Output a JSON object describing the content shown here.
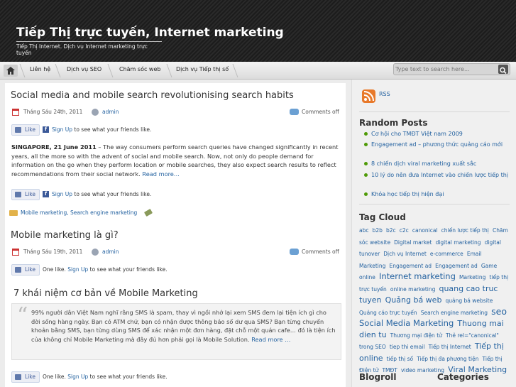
{
  "header": {
    "title": "Tiếp Thị trực tuyến, Internet marketing",
    "description": "Tiếp Thị Internet. Dịch vụ Internet marketing trực tuyến"
  },
  "nav": {
    "home_icon": "home-icon",
    "items": [
      "Liên hệ",
      "Dịch vụ SEO",
      "Chăm sóc web",
      "Dịch vụ Tiếp thị số"
    ],
    "search_placeholder": "Type text to search here..."
  },
  "posts": [
    {
      "title": "Social media and mobile search revolutionising search habits",
      "date": "Tháng Sáu 24th, 2011",
      "author": "admin",
      "comments": "Comments off",
      "like_label": "Like",
      "fb_signup_prefix": "Sign Up",
      "fb_signup_suffix": " to see what your friends like.",
      "excerpt_lead": "SINGAPORE, 21 June 2011",
      "excerpt_body": " – The way consumers perform search queries have changed significantly in recent years, all the more so with the advent of social and mobile search. Now, not only do people demand for information on the go when they perform location or mobile searches, they also expect search results to reflect recommendations from their social network. ",
      "read_more": "Read more…",
      "categories": "Mobile marketing, Search engine marketing"
    },
    {
      "title": "Mobile marketing là gì?",
      "date": "Tháng Sáu 19th, 2011",
      "author": "admin",
      "comments": "Comments off",
      "like_label": "Like",
      "fb_prefix": "One like. ",
      "fb_signup": "Sign Up",
      "fb_suffix": " to see what your friends like.",
      "subtitle": "7 khái niệm cơ bản về Mobile Marketing",
      "quote": "99% người dân Việt Nam nghĩ rằng SMS là spam, thay vì ngồi nhớ lại xem SMS đem lại tiện ích gì cho đời sống hàng ngày. Bạn có ATM chứ, bạn có nhận được thông báo số dư qua SMS? Bạn từng chuyển khoản bằng SMS, bạn từng dùng SMS để xác nhận một đơn hàng, đặt chỗ một quán cafe… đó là tiện ích của không chỉ Mobile Marketing mà đây đủ hơn phải gọi là Mobile Solution. ",
      "quote_read_more": "Read more …",
      "like_label_2": "Like",
      "fb_prefix_2": "One like. ",
      "fb_signup_2": "Sign Up",
      "fb_suffix_2": " to see what your friends like."
    }
  ],
  "sidebar": {
    "rss_label": "RSS",
    "random_posts_heading": "Random Posts",
    "random_posts": [
      "Cơ hội cho TMĐT Việt nam 2009",
      "Engagement ad – phương thức quảng cáo mới",
      "8 chiến dịch viral marketing xuất sắc",
      "10 lý do nên đưa Internet vào chiến lược tiếp thị",
      "Khóa học tiếp thị hiện đại"
    ],
    "tag_cloud_heading": "Tag Cloud",
    "tags": [
      {
        "t": "abc",
        "s": 7.5
      },
      {
        "t": "b2b",
        "s": 7.5
      },
      {
        "t": "b2c",
        "s": 7.5
      },
      {
        "t": "c2c",
        "s": 7.5
      },
      {
        "t": "canonical",
        "s": 7.5
      },
      {
        "t": "chiến lược tiếp thị",
        "s": 7.5
      },
      {
        "t": "Chăm sóc website",
        "s": 7.5
      },
      {
        "t": "Digital market",
        "s": 7.5
      },
      {
        "t": "digital marketing",
        "s": 7.5
      },
      {
        "t": "digital tunover",
        "s": 7.5
      },
      {
        "t": "Dịch vụ Internet",
        "s": 7.5
      },
      {
        "t": "e-commerce",
        "s": 7.5
      },
      {
        "t": "Email Marketing",
        "s": 7.5
      },
      {
        "t": "Engagement ad",
        "s": 7.5
      },
      {
        "t": "Engagement ad",
        "s": 7.5
      },
      {
        "t": "Game online",
        "s": 7.5
      },
      {
        "t": "Internet marketing",
        "s": 11.5
      },
      {
        "t": "Marketing",
        "s": 7.5
      },
      {
        "t": "tiếp thị",
        "s": 7.5
      },
      {
        "t": "trực tuyến",
        "s": 7.5
      },
      {
        "t": "online marketing",
        "s": 7.5
      },
      {
        "t": "quang cao truc tuyen",
        "s": 11
      },
      {
        "t": "Quảng bá web",
        "s": 11
      },
      {
        "t": "quảng bá website",
        "s": 7.5
      },
      {
        "t": "Quảng cáo trực tuyến",
        "s": 7.5
      },
      {
        "t": "Search engine marketing",
        "s": 7.5
      },
      {
        "t": "seo",
        "s": 12.5
      },
      {
        "t": "Social Media Marketing",
        "s": 11.5
      },
      {
        "t": "Thuong mai dien tu",
        "s": 11
      },
      {
        "t": "Thương mại điện tử",
        "s": 7.5
      },
      {
        "t": "Thẻ rel=\"canonical\"",
        "s": 7.5
      },
      {
        "t": "trong SEO",
        "s": 7.5
      },
      {
        "t": "tiep thi email",
        "s": 7.5
      },
      {
        "t": "Tiếp thị Internet",
        "s": 7.5
      },
      {
        "t": "Tiếp thị online",
        "s": 11
      },
      {
        "t": "tiếp thị số",
        "s": 7.5
      },
      {
        "t": "Tiếp thị đa phương tiện",
        "s": 7.5
      },
      {
        "t": "Tiếp thị Điện tử",
        "s": 7.5
      },
      {
        "t": "TMĐT",
        "s": 7.5
      },
      {
        "t": "video marketing",
        "s": 7.5
      },
      {
        "t": "Viral Marketing",
        "s": 11
      }
    ],
    "blogroll_heading": "Blogroll",
    "categories_heading": "Categories"
  },
  "colors": {
    "link": "#2462a0",
    "accent_rss": "#e8792a",
    "facebook": "#3b5998"
  }
}
